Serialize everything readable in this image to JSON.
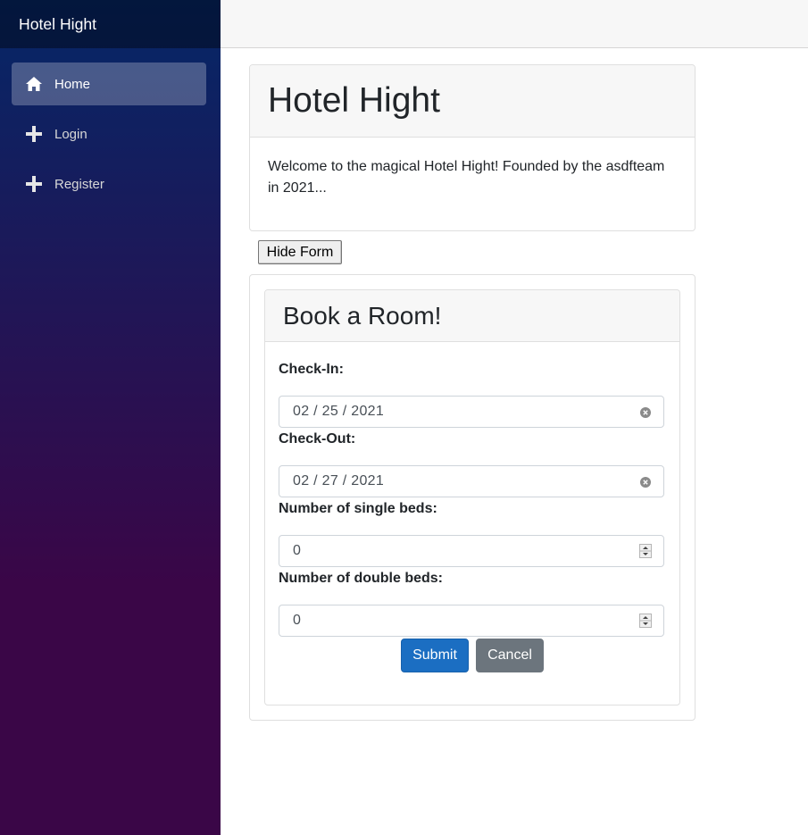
{
  "app": {
    "brand": "Hotel Hight"
  },
  "nav": {
    "items": [
      {
        "label": "Home",
        "icon": "home-icon",
        "active": true
      },
      {
        "label": "Login",
        "icon": "plus-icon",
        "active": false
      },
      {
        "label": "Register",
        "icon": "plus-icon",
        "active": false
      }
    ]
  },
  "hero": {
    "title": "Hotel Hight",
    "text_line1": "Welcome to the magical Hotel Hight! Founded by the asdfteam",
    "text_line2": "in 2021..."
  },
  "toggle": {
    "label": "Hide Form"
  },
  "booking": {
    "title": "Book a Room!",
    "checkin_label": "Check-In:",
    "checkin_value": "02 / 25 / 2021",
    "checkout_label": "Check-Out:",
    "checkout_value": "02 / 27 / 2021",
    "single_label": "Number of single beds:",
    "single_value": "0",
    "double_label": "Number of double beds:",
    "double_value": "0",
    "submit_label": "Submit",
    "cancel_label": "Cancel"
  },
  "colors": {
    "sidebar_top": "#052767",
    "sidebar_bottom": "#3a0647",
    "primary": "#1b6ec2",
    "secondary": "#6c757d"
  }
}
